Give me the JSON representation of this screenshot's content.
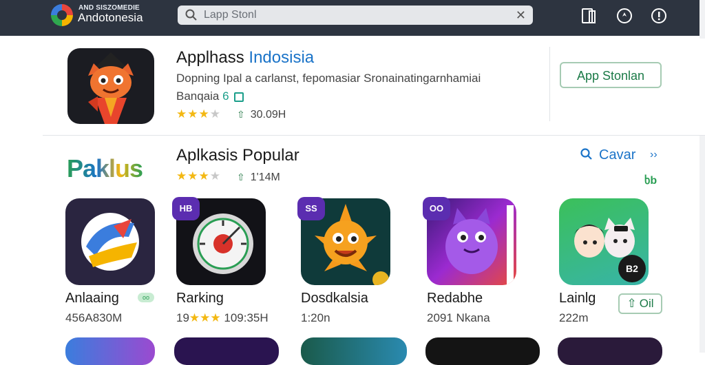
{
  "topbar": {
    "brand_small": "AND SISZOMEDIE",
    "brand_big": "Andotonesia",
    "search_placeholder": "Lapp Stonl",
    "clear_symbol": "✕",
    "icons": [
      "tablet-icon",
      "compass-icon",
      "alert-icon"
    ]
  },
  "featured": {
    "title_part1": "Applhass ",
    "title_part2": "Indosisia",
    "description": "Dopning Ipal a carlanst, fepomasiar Sronainatingarnhamiai",
    "category": "Banqaia",
    "category_badge": "6",
    "rating_stars": "★★★",
    "rating_half": "★",
    "downloads": "30.09H",
    "store_button": "App Stonlan"
  },
  "popular": {
    "brand_word": "Paklus",
    "title": "Aplkasis Popular",
    "rating_stars": "★★★",
    "rating_half": "★",
    "downloads": "1'14M",
    "see_all": "Cavar",
    "chevrons": "››",
    "corner_tag": "ხb",
    "apps": [
      {
        "name": "Anlaaing",
        "meta": "456A830M",
        "pill": "oo"
      },
      {
        "name": "Rarking",
        "meta_prefix": "19",
        "stars": "★★★",
        "meta_suffix": " 109:35H",
        "ribbon": "HB"
      },
      {
        "name": "Dosdkalsia",
        "meta": "1:20n",
        "ribbon": "SS"
      },
      {
        "name": "Redabhe",
        "meta": "2091 Nkana",
        "ribbon": "OO"
      },
      {
        "name": "Lainlg",
        "meta": "222m",
        "button": "Oil",
        "badge": "B2"
      }
    ]
  },
  "colors": {
    "topbar_bg": "#2d3440",
    "accent_blue": "#1a73c8",
    "accent_green": "#1b7a47",
    "star": "#f3b813"
  }
}
